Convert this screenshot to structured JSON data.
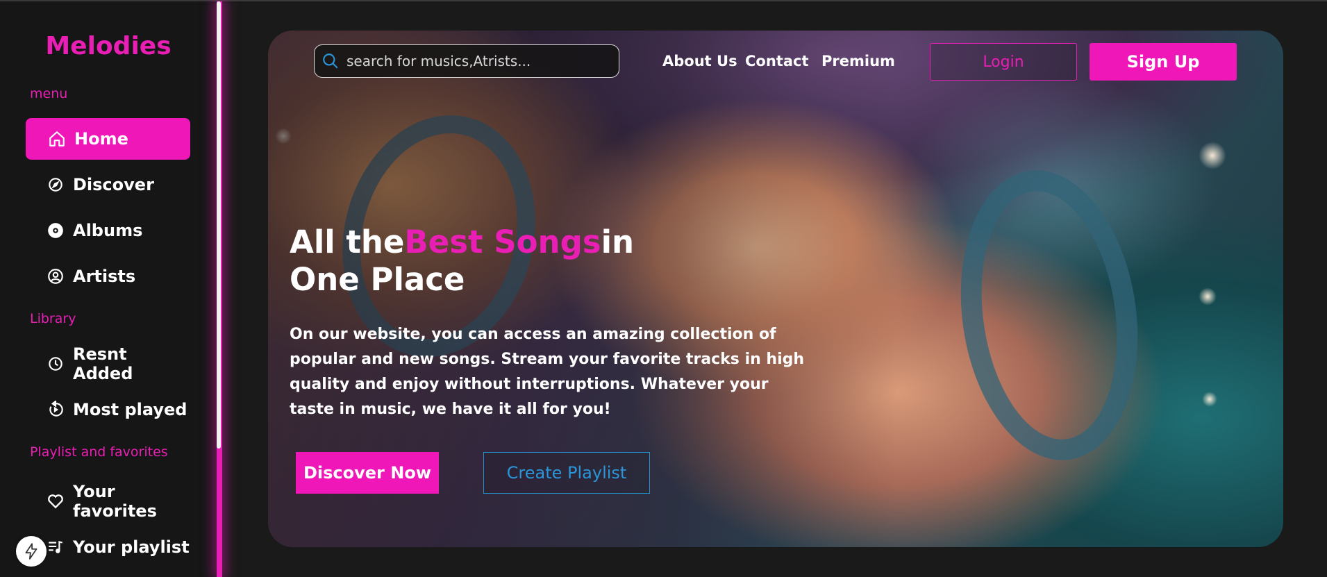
{
  "brand": "Melodies",
  "sidebar": {
    "menu_label": "menu",
    "menu_items": [
      {
        "label": "Home",
        "icon": "home-icon",
        "active": true
      },
      {
        "label": "Discover",
        "icon": "compass-icon"
      },
      {
        "label": "Albums",
        "icon": "disc-icon"
      },
      {
        "label": "Artists",
        "icon": "user-circle-icon"
      }
    ],
    "library_label": "Library",
    "library_items": [
      {
        "label": "Resnt Added",
        "icon": "clock-icon"
      },
      {
        "label": "Most played",
        "icon": "replay-icon"
      }
    ],
    "playlist_label": "Playlist and favorites",
    "playlist_items": [
      {
        "label": "Your favorites",
        "icon": "heart-icon"
      },
      {
        "label": "Your playlist",
        "icon": "music-list-icon"
      }
    ]
  },
  "header": {
    "search_placeholder": "search for musics,Atrists...",
    "links": [
      "About Us",
      "Contact",
      "Premium"
    ],
    "login_label": "Login",
    "signup_label": "Sign Up"
  },
  "hero": {
    "headline_part1": "All the",
    "headline_accent": "Best Songs",
    "headline_part2": "in",
    "headline_line2": "One Place",
    "description": "On our website, you can access an amazing collection of popular and new songs. Stream your favorite tracks in high quality and enjoy without interruptions. Whatever your taste in music, we have it all for you!",
    "discover_label": "Discover Now",
    "create_label": "Create Playlist"
  },
  "colors": {
    "accent": "#ef17b7",
    "background": "#1a1a1a",
    "secondary_accent": "#2a95d8"
  }
}
